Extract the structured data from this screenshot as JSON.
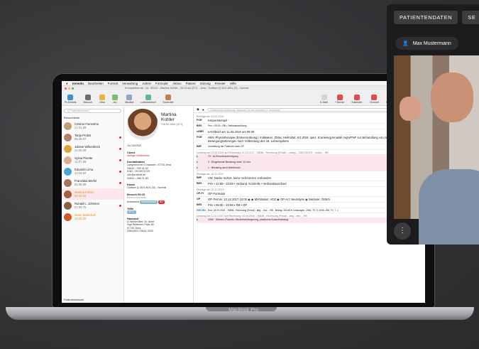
{
  "device_label": "MacBook Pro",
  "menubar": {
    "app": "tomedo",
    "items": [
      "Bearbeiten",
      "Format",
      "Verwaltung",
      "Admin",
      "Formular",
      "Aktion",
      "Patient",
      "Sitzung",
      "Fenster",
      "Hilfe"
    ]
  },
  "window_title": "Kompaktformat - Nr.: 30120 - Martina Kohler - 26.02.82 (37J) - Jena - Gottiser (2,30/1,80/1,15) - Normal",
  "toolbar": {
    "left": [
      "Pt-Details",
      "Besuch",
      "Obw",
      "AU",
      "Medika",
      "Labomerlauf",
      "Kontrolle"
    ],
    "right": [
      "E-Mail",
      "+Termin",
      "Kalender",
      "Termine",
      "Nachrichten",
      "Abrechnung"
    ]
  },
  "sidebar": {
    "search_placeholder": "Q Patientensuche",
    "header": "Besuchsliste",
    "patients": [
      {
        "name": "Cosimo Fiorentino",
        "date": "17.01.89"
      },
      {
        "name": "Tanja Probst",
        "date": "05.06.87"
      },
      {
        "name": "Juliane Wilkenbeck",
        "date": "14.05.08"
      },
      {
        "name": "Sylvia Pinette",
        "date": "14.07.66"
      },
      {
        "name": "Eduardo Lima",
        "date": "13.04.92"
      },
      {
        "name": "Franziska Werfel",
        "date": "05.06.89"
      },
      {
        "name": "Martina Kohler",
        "date": "26.02.82"
      },
      {
        "name": "Ronald L. Johnson",
        "date": "07.09.75"
      },
      {
        "name": "Marie Ballschuß",
        "date": "26.03.80"
      }
    ],
    "footer": "Patientenhistorie"
  },
  "patient": {
    "first": "Martina",
    "last": "Kohler",
    "dob": "*26.02.1982 (37J)",
    "gu": "GU 05/2020",
    "caves_label": "Caves",
    "caves_value": "Allergie Mokknüsen",
    "contact_label": "Kontaktdaten",
    "address": "Laegenhorner Chaussee, 07743 Jena",
    "phone1": "03641 - 399 41 62",
    "phone2": "0162 - 9376572729",
    "email": "info@zollsoft.de",
    "fax": "03641 - 268 71 83",
    "kasse_label": "Kasse",
    "kasse_value": "Gottiser (2,30/1,80/1,15) - Normal",
    "besuch_label": "Besuch 09:15",
    "besuch_note": "Besuchshinweis",
    "termin_status": "Anwesend",
    "termin_btn": "Sofortaktivität",
    "behandler_badge": "BD",
    "team_label": "TeBe",
    "team_badge": "ARZT",
    "hausarzt_label": "Hausarzt",
    "ha_name": "Q Weißmüller, Dr. Anke",
    "ha_street": "Inge Beisheim Platz 60",
    "ha_city": "07749 Jena",
    "ha_tel": "03641521 03641 3242"
  },
  "journal": {
    "search_placeholder": "Karteieintrag verfassung, Diagnose etc hier eingeben (z. Textsuche)",
    "date": "11. 3. 2019",
    "groups": [
      {
        "header": "Einträge am 11.03.2019",
        "rows": [
          {
            "tag": "FOR",
            "text": "Körperstempel -"
          },
          {
            "tag": "BES",
            "text": "Priv • 09:15 • RB • Selbstanmeldung"
          },
          {
            "tag": "eABR",
            "text": "eArztbrief am 11.03.2019 um 09:30"
          },
          {
            "tag": "FOR",
            "text": "HMV Physiotherapie (Erstverordnung); Indikation: ZN3a; Heilmittel: KG-ZNS: spez. Krankengymnastik Vojta/PNF zur Behandlung von zentralen Bewegungsstörungen nach Vollendung des 18. Lebensjahres"
          },
          {
            "tag": "BEF",
            "text": "Vorstellung der Patientin nach OP"
          }
        ]
      },
      {
        "header": "Leistung am 11.03.2019 auf Rechnung: 11.11.2017 - 76838 - Rechnung (Privat) - unabg. - GELÖSCHT - unbez. - RB",
        "rows": [
          {
            "tag": "L",
            "text": "70 · AU/Kurzbescheinigung"
          },
          {
            "tag": "L",
            "text": "3 · Eingehende Beratung mind. 10 min."
          },
          {
            "tag": "L",
            "text": "1 · Beratung auch telefonisch"
          }
        ]
      },
      {
        "header": "Einträge am 16.12.2017",
        "rows": [
          {
            "tag": "BEF",
            "text": "VW, Narbe reizlos, keine Schmerzen vorhanden"
          },
          {
            "tag": "BES",
            "text": "Priv • 22:59 - 23:59 • Verband, Kontrolle • Verbandswechsel"
          }
        ]
      },
      {
        "header": "Einträge am 12.12.2017",
        "rows": [
          {
            "tag": "OP-Pr",
            "text": "OP-Formular"
          },
          {
            "tag": "OP",
            "text": "OP-Termin: 12.12.2017 10:00 ◉ ◉ MHStation: AOZ ◉ OP-Art: Neurolyse ◉ Narkose: Örtlich"
          },
          {
            "tag": "BES",
            "text": "Priv • 09:30 - 23:59 • RB • OP"
          },
          {
            "tag": "RECHN",
            "text": "Erst: 18.04.2019 - 76836 - Rechnung (Privat) - abg. - bez. - RB - Betrag: 333,60 € Leistungen: 2064, 70, 3, 2006, 265, 70, 7, 1"
          }
        ]
      },
      {
        "header": "Leistung am 12.12.2017 auf Rechnung: 18.04.2018 - 76836 - Rechnung (Privat) - abg. - bez. - RB",
        "rows": [
          {
            "tag": "L",
            "text": "2064 · Sehnen-/Faszien-/Muskelverlängerung, plastische Ausschneidung"
          }
        ]
      }
    ]
  },
  "video": {
    "tab1": "PATIENTENDATEN",
    "tab2": "SE",
    "caller": "Max Mustermann"
  },
  "colors": {
    "accent": "#e03030",
    "selected": "#fde7ea",
    "orange": "#e38a1f"
  }
}
